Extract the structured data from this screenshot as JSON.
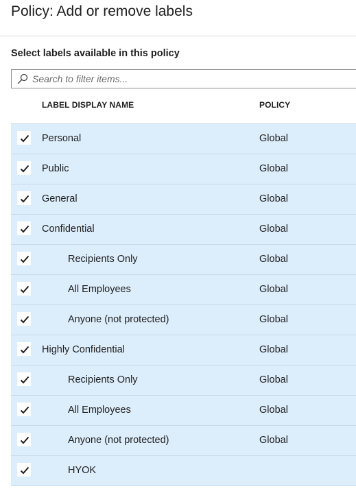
{
  "page": {
    "title": "Policy: Add or remove labels",
    "section_heading": "Select labels available in this policy"
  },
  "search": {
    "placeholder": "Search to filter items...",
    "icon": "search-icon"
  },
  "table": {
    "columns": {
      "name": "LABEL DISPLAY NAME",
      "policy": "POLICY"
    },
    "rows": [
      {
        "name": "Personal",
        "policy": "Global",
        "checked": true,
        "level": 0
      },
      {
        "name": "Public",
        "policy": "Global",
        "checked": true,
        "level": 0
      },
      {
        "name": "General",
        "policy": "Global",
        "checked": true,
        "level": 0
      },
      {
        "name": "Confidential",
        "policy": "Global",
        "checked": true,
        "level": 0
      },
      {
        "name": "Recipients Only",
        "policy": "Global",
        "checked": true,
        "level": 1
      },
      {
        "name": "All Employees",
        "policy": "Global",
        "checked": true,
        "level": 1
      },
      {
        "name": "Anyone (not protected)",
        "policy": "Global",
        "checked": true,
        "level": 1
      },
      {
        "name": "Highly Confidential",
        "policy": "Global",
        "checked": true,
        "level": 0
      },
      {
        "name": "Recipients Only",
        "policy": "Global",
        "checked": true,
        "level": 1
      },
      {
        "name": "All Employees",
        "policy": "Global",
        "checked": true,
        "level": 1
      },
      {
        "name": "Anyone (not protected)",
        "policy": "Global",
        "checked": true,
        "level": 1
      },
      {
        "name": "HYOK",
        "policy": "",
        "checked": true,
        "level": 1
      }
    ]
  },
  "colors": {
    "row_selected_bg": "#dcedfb",
    "row_border": "#c9d9e8",
    "text": "#1e1e1e"
  }
}
